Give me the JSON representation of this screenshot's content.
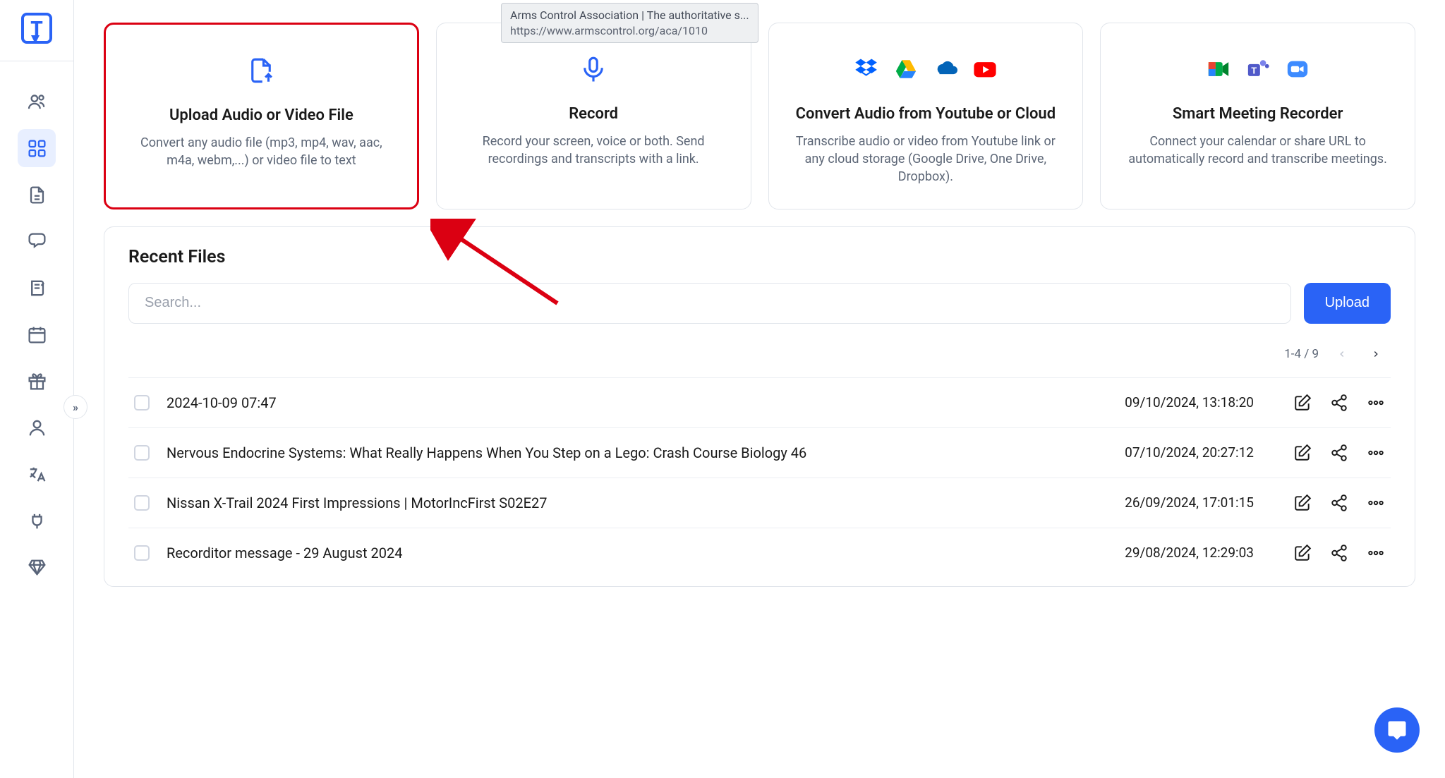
{
  "tooltip": {
    "title": "Arms Control Association | The authoritative s...",
    "url": "https://www.armscontrol.org/aca/1010"
  },
  "cards": {
    "upload": {
      "title": "Upload Audio or Video File",
      "desc": "Convert any audio file (mp3, mp4, wav, aac, m4a, webm,...) or video file to text"
    },
    "record": {
      "title": "Record",
      "desc": "Record your screen, voice or both. Send recordings and transcripts with a link."
    },
    "cloud": {
      "title": "Convert Audio from Youtube or Cloud",
      "desc": "Transcribe audio or video from Youtube link or any cloud storage (Google Drive, One Drive, Dropbox)."
    },
    "meeting": {
      "title": "Smart Meeting Recorder",
      "desc": "Connect your calendar or share URL to automatically record and transcribe meetings."
    }
  },
  "recent": {
    "title": "Recent Files",
    "search_placeholder": "Search...",
    "upload_label": "Upload",
    "pager": "1-4 / 9",
    "files": [
      {
        "name": "2024-10-09 07:47",
        "date": "09/10/2024, 13:18:20"
      },
      {
        "name": "Nervous Endocrine Systems: What Really Happens When You Step on a Lego: Crash Course Biology 46",
        "date": "07/10/2024, 20:27:12"
      },
      {
        "name": "Nissan X-Trail 2024 First Impressions | MotorIncFirst S02E27",
        "date": "26/09/2024, 17:01:15"
      },
      {
        "name": "Recorditor message - 29 August 2024",
        "date": "29/08/2024, 12:29:03"
      }
    ]
  }
}
